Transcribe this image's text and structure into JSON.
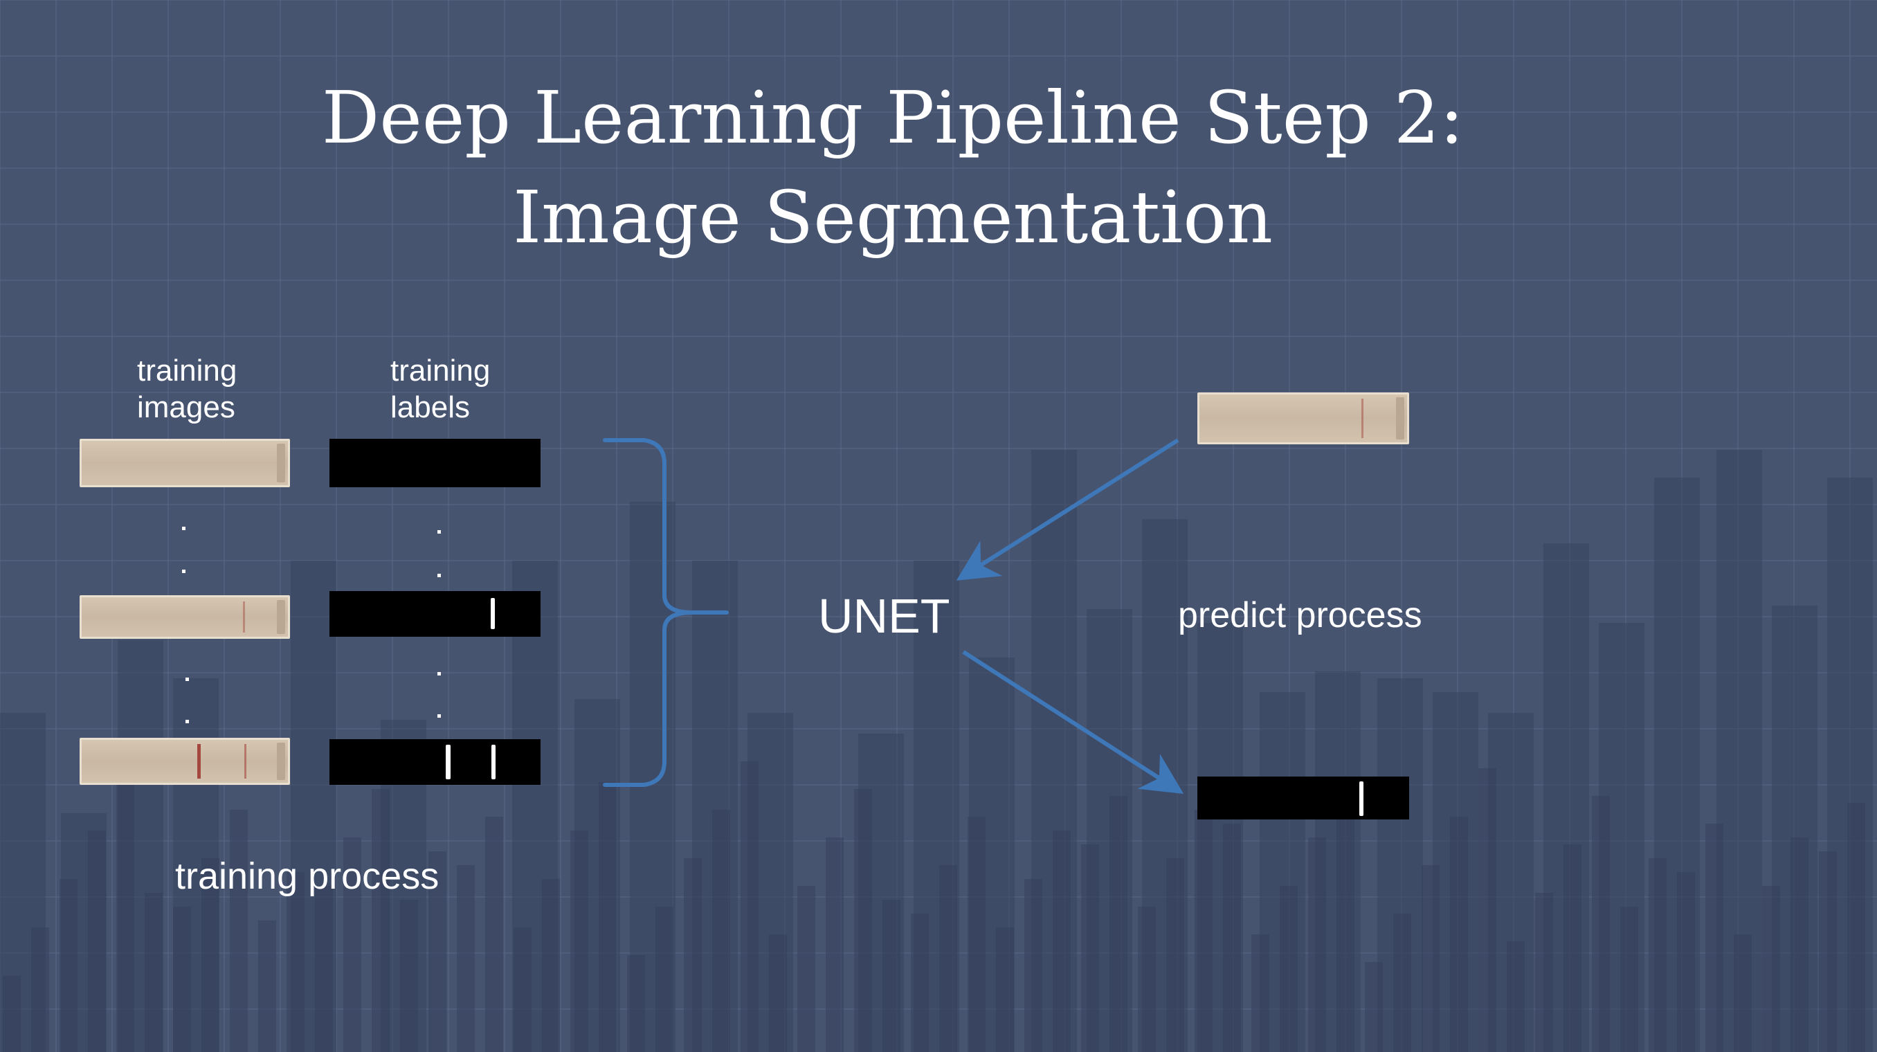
{
  "slide": {
    "title_line_1": "Deep Learning Pipeline Step 2:",
    "title_line_2": "Image Segmentation"
  },
  "training": {
    "images_label": "training\nimages",
    "labels_label": "training\nlabels",
    "process_label": "training process"
  },
  "model": {
    "name": "UNET"
  },
  "predict": {
    "process_label": "predict process"
  },
  "colors": {
    "background": "#475470",
    "grid_line": "#5a6785",
    "bar_dark": "#34405c",
    "arrow": "#3f78b8",
    "mask": "#000000",
    "strip": "#d2c2ad",
    "band": "#a3473f"
  },
  "icons": [
    "curly-brace-icon",
    "arrow-in-icon",
    "arrow-out-icon"
  ]
}
